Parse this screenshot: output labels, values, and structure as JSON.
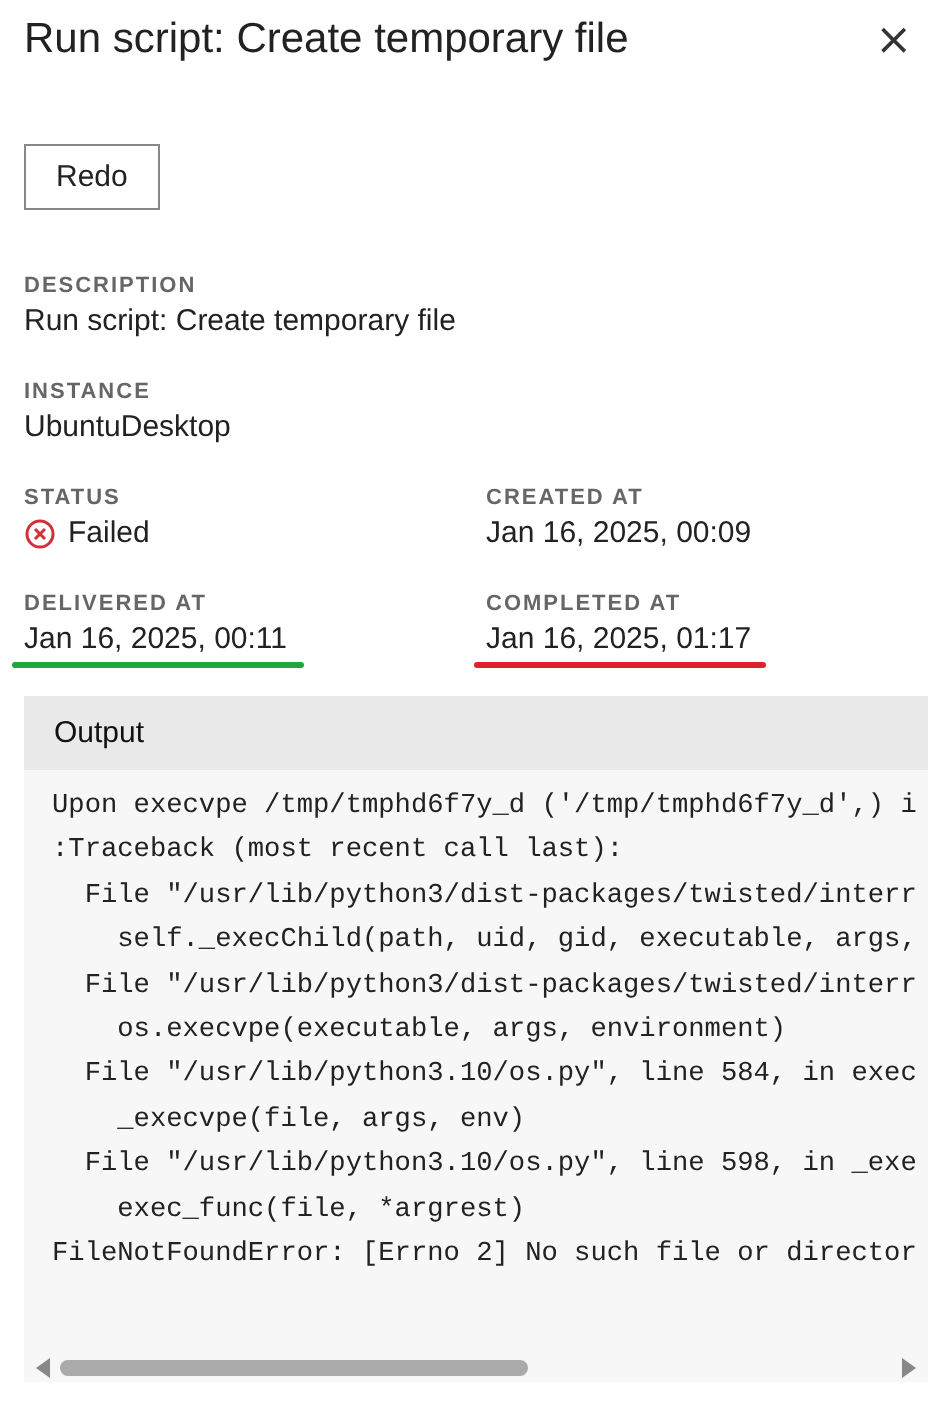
{
  "header": {
    "title": "Run script: Create temporary file",
    "close": "×"
  },
  "actions": [
    {
      "label": "Redo"
    }
  ],
  "details": [
    {
      "fields": [
        {
          "label": "DESCRIPTION",
          "value": "Run script: Create temporary file",
          "kind": "text"
        }
      ]
    },
    {
      "fields": [
        {
          "label": "INSTANCE",
          "value": "UbuntuDesktop",
          "kind": "text"
        }
      ]
    },
    {
      "fields": [
        {
          "label": "STATUS",
          "value": "Failed",
          "kind": "status"
        },
        {
          "label": "CREATED AT",
          "value": "Jan 16, 2025, 00:09",
          "kind": "text"
        }
      ]
    },
    {
      "fields": [
        {
          "label": "DELIVERED AT",
          "value": "Jan 16, 2025, 00:11",
          "kind": "text",
          "color": "#1ea83c"
        },
        {
          "label": "COMPLETED AT",
          "value": "Jan 16, 2025, 01:17",
          "kind": "text",
          "color": "#e0202a"
        }
      ]
    }
  ],
  "output": {
    "title": "Output",
    "lines": [
      "Upon execvpe /tmp/tmphd6f7y_d ('/tmp/tmphd6f7y_d',) i",
      ":Traceback (most recent call last):",
      "  File \"/usr/lib/python3/dist-packages/twisted/interr",
      "    self._execChild(path, uid, gid, executable, args,",
      "  File \"/usr/lib/python3/dist-packages/twisted/interr",
      "    os.execvpe(executable, args, environment)",
      "  File \"/usr/lib/python3.10/os.py\", line 584, in exec",
      "    _execvpe(file, args, env)",
      "  File \"/usr/lib/python3.10/os.py\", line 598, in _exe",
      "    exec_func(file, *argrest)",
      "FileNotFoundError: [Errno 2] No such file or director"
    ]
  }
}
